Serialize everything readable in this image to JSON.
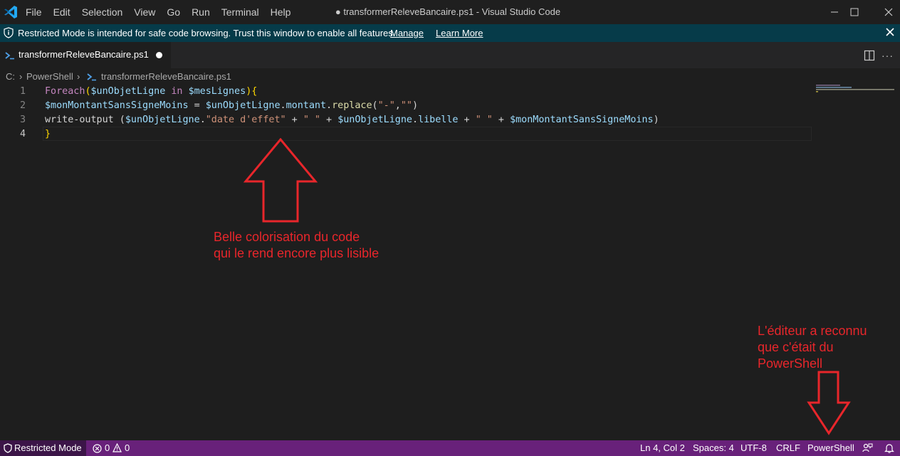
{
  "titlebar": {
    "menu": [
      "File",
      "Edit",
      "Selection",
      "View",
      "Go",
      "Run",
      "Terminal",
      "Help"
    ],
    "title": "● transformerReleveBancaire.ps1 - Visual Studio Code"
  },
  "banner": {
    "text": "Restricted Mode is intended for safe code browsing. Trust this window to enable all features.",
    "manage": "Manage",
    "learn_more": "Learn More"
  },
  "tab": {
    "name": "transformerReleveBancaire.ps1"
  },
  "breadcrumb": {
    "drive": "C:",
    "sep1": "›",
    "folder": "PowerShell",
    "sep2": "›",
    "file": "transformerReleveBancaire.ps1"
  },
  "editor": {
    "line_numbers": [
      "1",
      "2",
      "3",
      "4"
    ],
    "lines": [
      [
        {
          "t": "Foreach",
          "c": "kw"
        },
        {
          "t": "(",
          "c": "br"
        },
        {
          "t": "$unObjetLigne",
          "c": "var"
        },
        {
          "t": " ",
          "c": "pl"
        },
        {
          "t": "in",
          "c": "kw"
        },
        {
          "t": " ",
          "c": "pl"
        },
        {
          "t": "$mesLignes",
          "c": "var"
        },
        {
          "t": ")",
          "c": "br"
        },
        {
          "t": "{",
          "c": "br"
        }
      ],
      [
        {
          "t": "$monMontantSansSigneMoins",
          "c": "var"
        },
        {
          "t": " = ",
          "c": "pl"
        },
        {
          "t": "$unObjetLigne",
          "c": "var"
        },
        {
          "t": ".",
          "c": "pl"
        },
        {
          "t": "montant",
          "c": "var"
        },
        {
          "t": ".",
          "c": "pl"
        },
        {
          "t": "replace",
          "c": "fn"
        },
        {
          "t": "(",
          "c": "pl"
        },
        {
          "t": "\"-\"",
          "c": "str"
        },
        {
          "t": ",",
          "c": "pl"
        },
        {
          "t": "\"\"",
          "c": "str"
        },
        {
          "t": ")",
          "c": "pl"
        }
      ],
      [
        {
          "t": "write-output",
          "c": "pl"
        },
        {
          "t": " (",
          "c": "pl"
        },
        {
          "t": "$unObjetLigne",
          "c": "var"
        },
        {
          "t": ".",
          "c": "pl"
        },
        {
          "t": "\"date d'effet\"",
          "c": "str"
        },
        {
          "t": " + ",
          "c": "pl"
        },
        {
          "t": "\" \"",
          "c": "str"
        },
        {
          "t": " + ",
          "c": "pl"
        },
        {
          "t": "$unObjetLigne",
          "c": "var"
        },
        {
          "t": ".",
          "c": "pl"
        },
        {
          "t": "libelle",
          "c": "var"
        },
        {
          "t": " + ",
          "c": "pl"
        },
        {
          "t": "\" \"",
          "c": "str"
        },
        {
          "t": " + ",
          "c": "pl"
        },
        {
          "t": "$monMontantSansSigneMoins",
          "c": "var"
        },
        {
          "t": ")",
          "c": "pl"
        }
      ],
      [
        {
          "t": "}",
          "c": "br"
        }
      ]
    ]
  },
  "annotations": {
    "colorisation": [
      "Belle colorisation du code",
      "qui le rend encore plus lisible"
    ],
    "language": [
      "L'éditeur a reconnu",
      "que c'était du",
      "PowerShell"
    ]
  },
  "statusbar": {
    "restricted": "Restricted Mode",
    "errors": "0",
    "warnings": "0",
    "position": "Ln 4, Col 2",
    "spaces": "Spaces: 4",
    "encoding": "UTF-8",
    "eol": "CRLF",
    "language": "PowerShell"
  },
  "icons": {
    "app": "vscode-logo-icon",
    "banner": "shield-info-icon",
    "tab": "powershell-file-icon",
    "status_left": "shield-icon",
    "status_right": [
      "feedback-person-icon",
      "bell-icon"
    ]
  },
  "colors": {
    "annotation": "#e8262b",
    "statusbar": "#68217a",
    "banner": "#063b49"
  }
}
